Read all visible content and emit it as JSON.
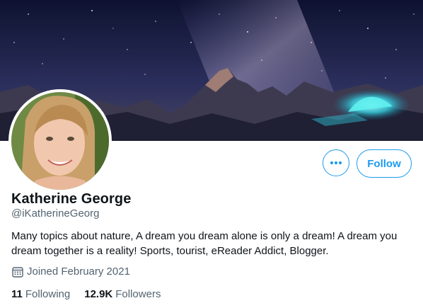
{
  "profile": {
    "name": "Katherine George",
    "handle": "@iKatherineGeorg",
    "bio": "Many topics about nature, A dream you dream alone is only a dream! A dream you dream together is a reality! Sports, tourist, eReader Addict, Blogger.",
    "joined": "Joined February 2021"
  },
  "actions": {
    "more_icon": "more-horizontal-icon",
    "follow_label": "Follow"
  },
  "stats": {
    "following_count": "11",
    "following_label": "Following",
    "followers_count": "12.9K",
    "followers_label": "Followers"
  },
  "colors": {
    "accent": "#1d9bf0",
    "secondary_text": "#536471",
    "primary_text": "#0f1419"
  }
}
